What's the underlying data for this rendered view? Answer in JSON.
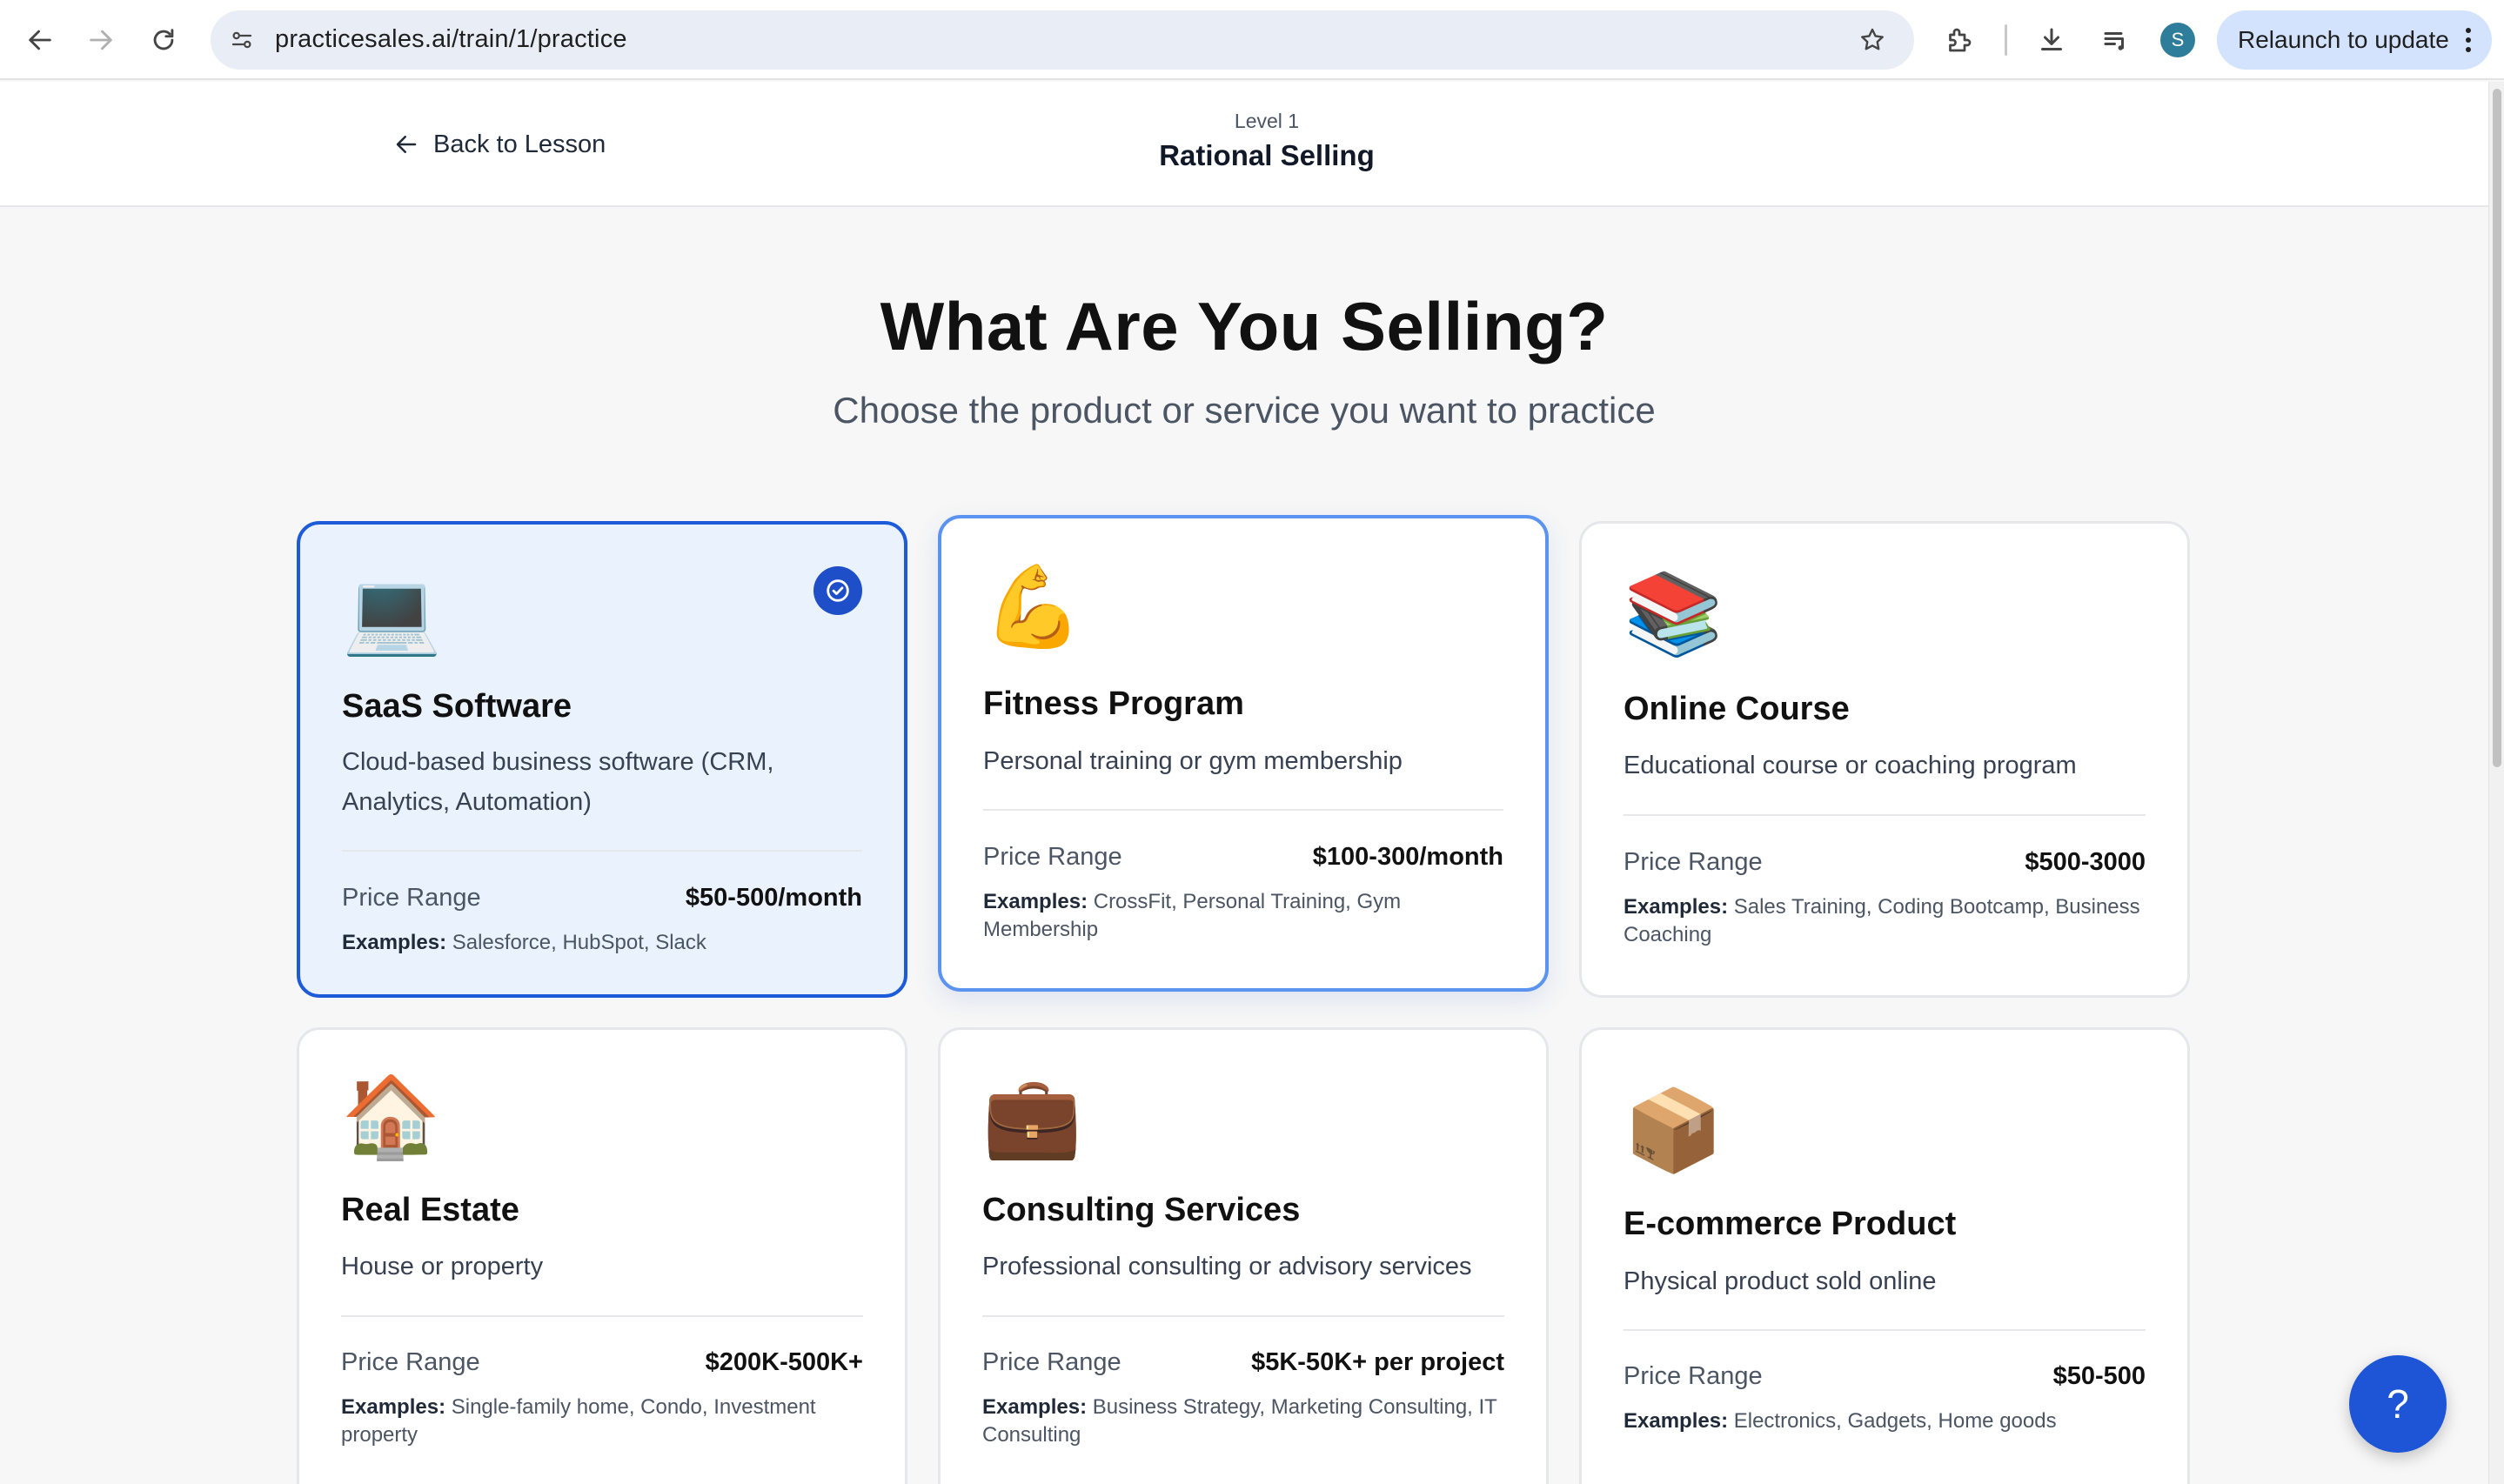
{
  "browser": {
    "url": "practicesales.ai/train/1/practice",
    "profile_initial": "S",
    "relaunch_label": "Relaunch to update"
  },
  "header": {
    "back_label": "Back to Lesson",
    "level": "Level 1",
    "lesson_title": "Rational Selling"
  },
  "main": {
    "title": "What Are You Selling?",
    "subtitle": "Choose the product or service you want to practice"
  },
  "price_label": "Price Range",
  "examples_label": "Examples:",
  "products": [
    {
      "emoji": "💻",
      "icon": "laptop-icon",
      "title": "SaaS Software",
      "description": "Cloud-based business software (CRM, Analytics, Automation)",
      "price": "$50-500/month",
      "examples": "Salesforce, HubSpot, Slack",
      "selected": true
    },
    {
      "emoji": "💪",
      "icon": "flexed-biceps-icon",
      "title": "Fitness Program",
      "description": "Personal training or gym membership",
      "price": "$100-300/month",
      "examples": "CrossFit, Personal Training, Gym Membership",
      "selected": false
    },
    {
      "emoji": "📚",
      "icon": "books-icon",
      "title": "Online Course",
      "description": "Educational course or coaching program",
      "price": "$500-3000",
      "examples": "Sales Training, Coding Bootcamp, Business Coaching",
      "selected": false
    },
    {
      "emoji": "🏠",
      "icon": "house-icon",
      "title": "Real Estate",
      "description": "House or property",
      "price": "$200K-500K+",
      "examples": "Single-family home, Condo, Investment property",
      "selected": false
    },
    {
      "emoji": "💼",
      "icon": "briefcase-icon",
      "title": "Consulting Services",
      "description": "Professional consulting or advisory services",
      "price": "$5K-50K+ per project",
      "examples": "Business Strategy, Marketing Consulting, IT Consulting",
      "selected": false
    },
    {
      "emoji": "📦",
      "icon": "package-icon",
      "title": "E-commerce Product",
      "description": "Physical product sold online",
      "price": "$50-500",
      "examples": "Electronics, Gadgets, Home goods",
      "selected": false
    }
  ],
  "help_button": "?",
  "colors": {
    "accent": "#1e55d6",
    "selected_bg": "#eaf2fe",
    "page_bg": "#f7f7f7"
  }
}
